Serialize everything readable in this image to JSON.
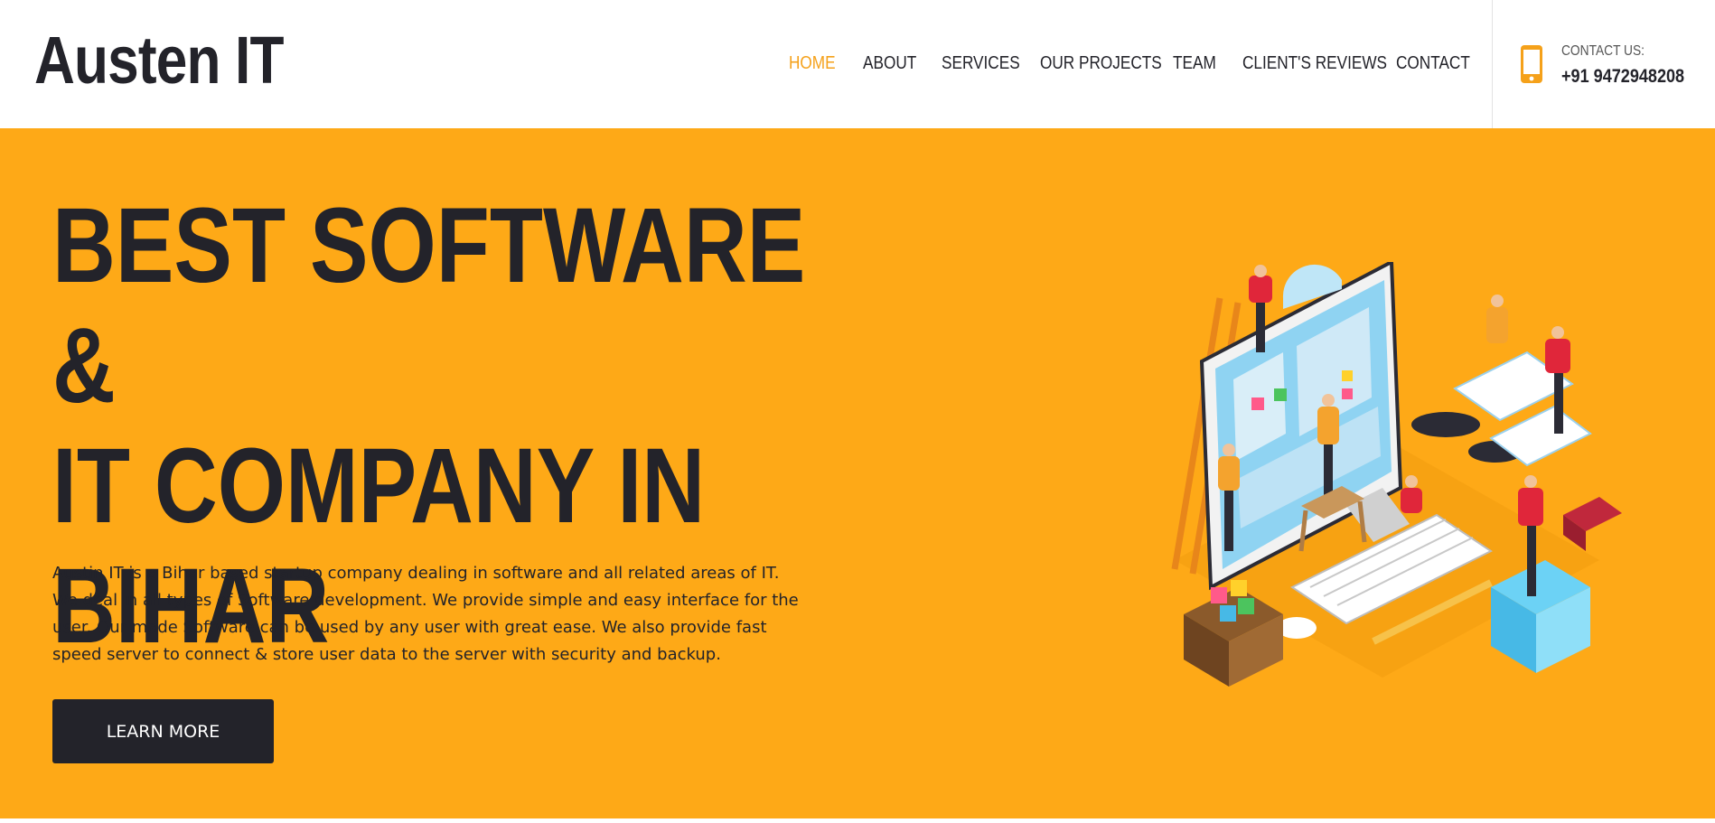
{
  "brand": {
    "name": "Austen IT"
  },
  "nav": {
    "items": [
      {
        "label": "HOME",
        "active": true
      },
      {
        "label": "ABOUT",
        "active": false
      },
      {
        "label": "SERVICES",
        "active": false
      },
      {
        "label": "OUR PROJECTS",
        "active": false
      },
      {
        "label": "TEAM",
        "active": false
      },
      {
        "label": "CLIENT'S REVIEWS",
        "active": false
      },
      {
        "label": "CONTACT",
        "active": false
      }
    ]
  },
  "contact": {
    "label": "CONTACT US:",
    "phone": "+91 9472948208",
    "icon": "mobile-phone-icon"
  },
  "hero": {
    "title_line1": "BEST SOFTWARE &",
    "title_line2": "IT COMPANY IN",
    "title_line3": "BIHAR",
    "description": "Austin IT is a Bihar based startup company dealing in software and all related areas of IT. We deal in all types of Software development. We provide simple and easy interface for the user. Our made Software can be used by any user with great ease. We also provide fast speed server to connect & store user data to the server with security and backup.",
    "button_label": "LEARN MORE"
  },
  "colors": {
    "accent": "#fea917",
    "nav_active": "#f5a11a",
    "dark": "#23232a",
    "background": "#ffffff"
  }
}
